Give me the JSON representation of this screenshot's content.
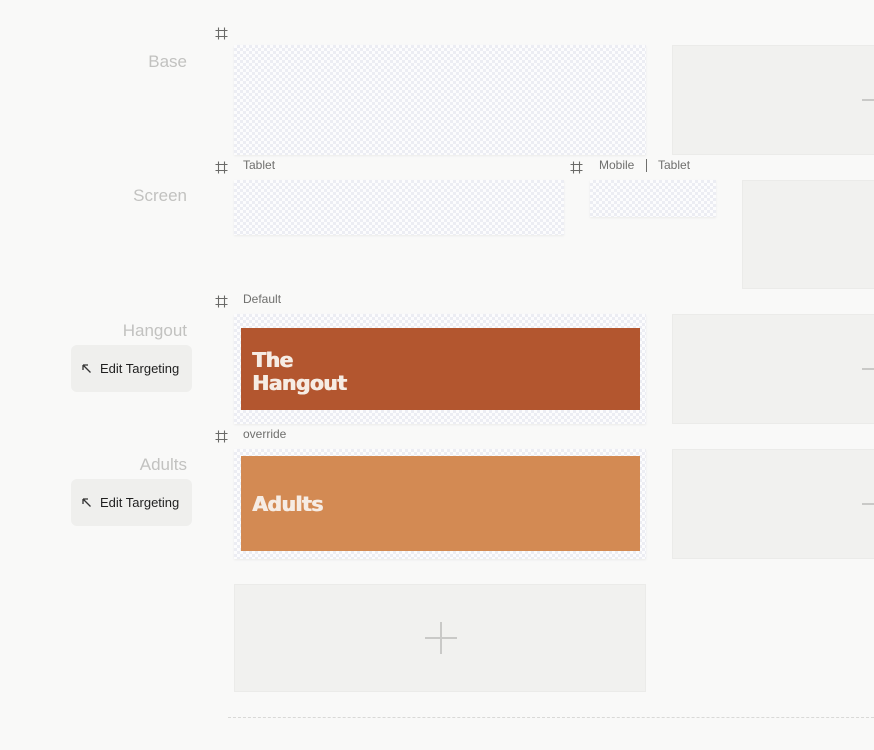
{
  "rows": [
    {
      "label": "Base"
    },
    {
      "label": "Screen"
    },
    {
      "label": "Hangout",
      "edit_button": "Edit Targeting"
    },
    {
      "label": "Adults",
      "edit_button": "Edit Targeting"
    }
  ],
  "frames": {
    "screen_tablet": "Tablet",
    "screen_mobile": "Mobile",
    "screen_mobile_tablet": "Tablet",
    "hangout": "Default",
    "adults": "override"
  },
  "banners": {
    "hangout": {
      "text": "The\nHangout",
      "color": "#b3562f"
    },
    "adults": {
      "text": "Adults",
      "color": "#d38a53"
    }
  },
  "icons": {
    "frame": "frame-icon",
    "edit": "arrow-up-left-icon",
    "add": "plus-icon"
  },
  "colors": {
    "background": "#f9f9f8",
    "placeholder": "#f1f1ef",
    "row_label": "#c2c2c0"
  }
}
